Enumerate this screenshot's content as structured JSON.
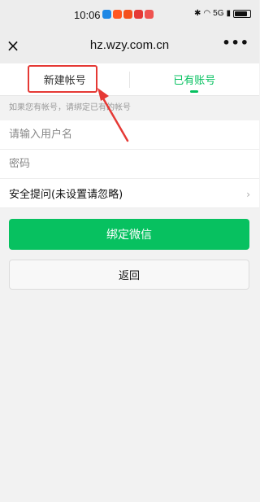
{
  "status_bar": {
    "time": "10:06",
    "network": "5G",
    "app_icon_colors": [
      "#1e88e5",
      "#ff5722",
      "#f4511e",
      "#e53935",
      "#ef5350"
    ]
  },
  "nav": {
    "close_icon": "×",
    "title": "hz.wzy.com.cn",
    "more_icon": "•••"
  },
  "tabs": {
    "new_account": "新建帐号",
    "existing_account": "已有账号"
  },
  "hint": "如果您有帐号，请绑定已有的帐号",
  "form": {
    "username_placeholder": "请输入用户名",
    "password_placeholder": "密码",
    "security_question": "安全提问(未设置请忽略)",
    "chevron": "›"
  },
  "buttons": {
    "bind": "绑定微信",
    "back": "返回"
  },
  "colors": {
    "accent": "#07c160",
    "annotation": "#e53935"
  }
}
